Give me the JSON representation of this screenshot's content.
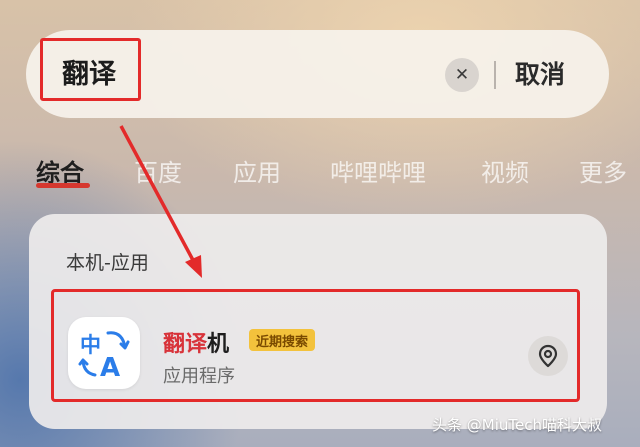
{
  "search": {
    "query": "翻译",
    "clear_icon": "close-icon",
    "cancel_label": "取消"
  },
  "tabs": [
    {
      "label": "综合",
      "active": true
    },
    {
      "label": "百度",
      "active": false
    },
    {
      "label": "应用",
      "active": false
    },
    {
      "label": "哔哩哔哩",
      "active": false
    },
    {
      "label": "视频",
      "active": false
    },
    {
      "label": "更多",
      "active": false
    }
  ],
  "results": {
    "section_title": "本机-应用",
    "app": {
      "name_highlight": "翻译",
      "name_rest": "机",
      "badge": "近期搜索",
      "type": "应用程序",
      "icon": "translate-app-icon",
      "action_icon": "location-pin-icon"
    }
  },
  "watermark": "头条 @MiuTech喵科大叔",
  "colors": {
    "accent_red": "#d6382f",
    "annotation_red": "#e32a2a",
    "badge_bg": "#f3c23c",
    "icon_blue": "#2b7de9"
  }
}
